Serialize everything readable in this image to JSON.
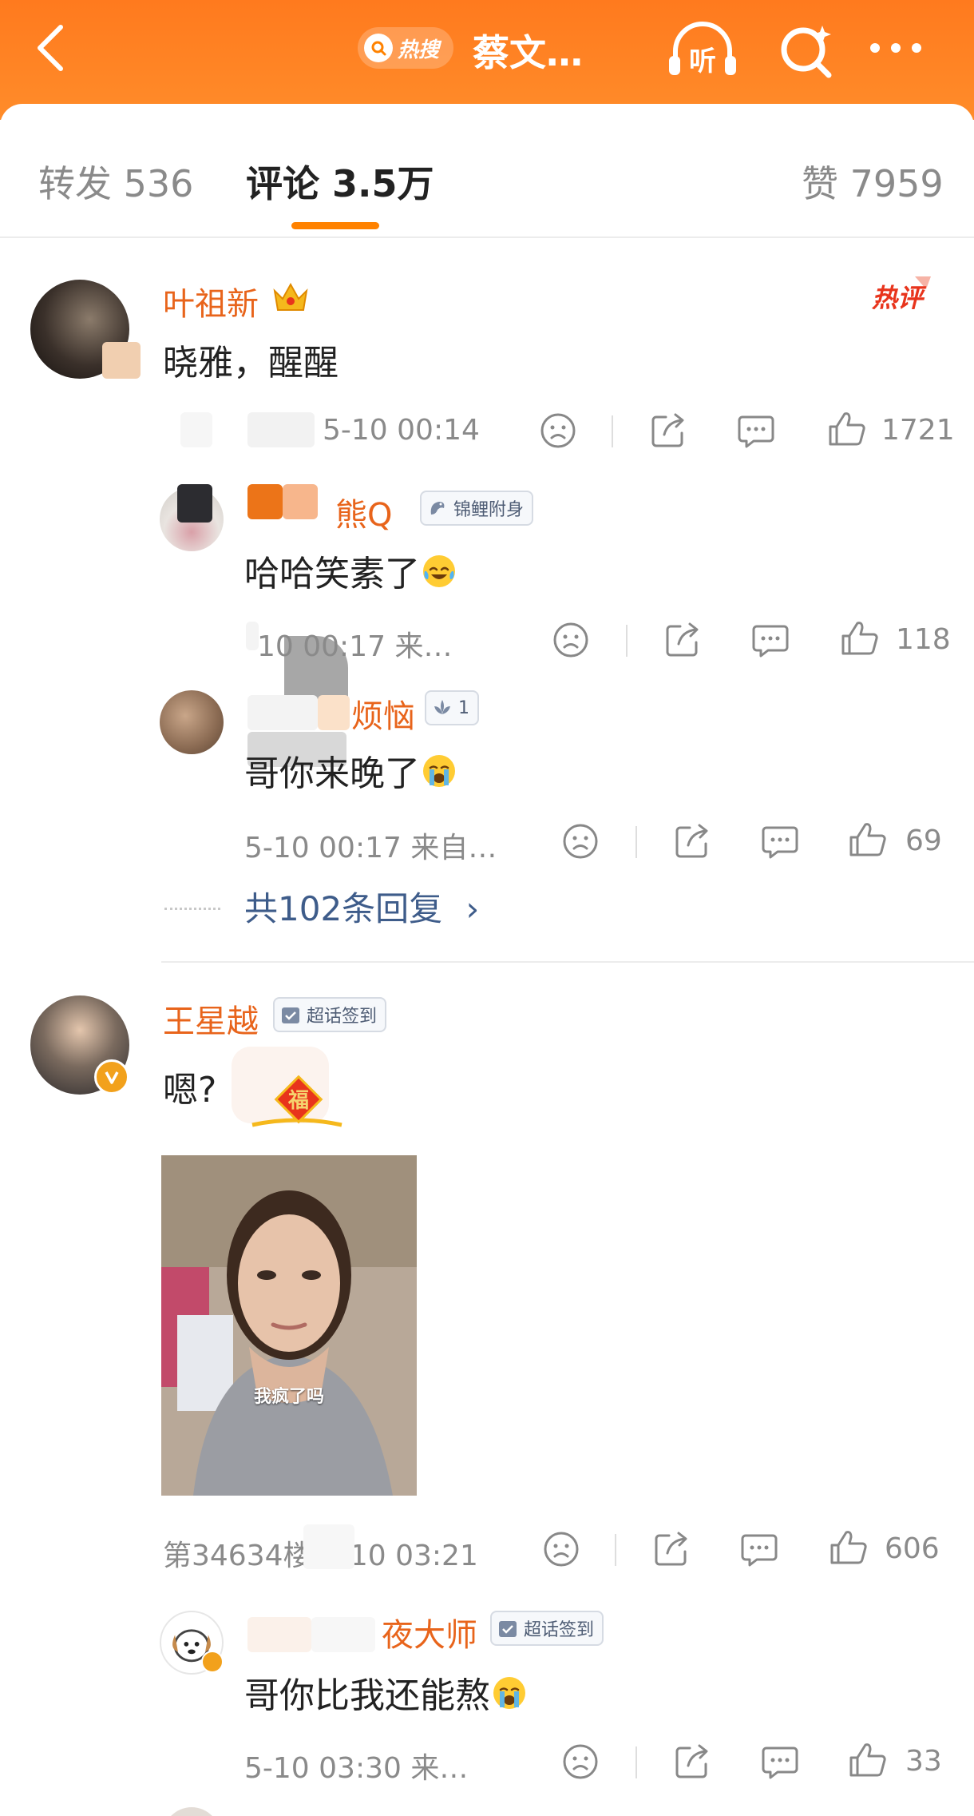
{
  "header": {
    "hot_search_label": "热搜",
    "topic_title": "蔡文…",
    "listen_label": "听",
    "accent_color": "#ff7a1e"
  },
  "tabs": {
    "reposts": "转发 536",
    "comments": "评论 3.5万",
    "likes": "赞 7959"
  },
  "comments": [
    {
      "user": "叶祖新",
      "hot_label": "热评",
      "text": "晓雅，醒醒",
      "time": "5-10 00:14",
      "likes": "1721",
      "replies": [
        {
          "user": "熊Q",
          "badge": "锦鲤附身",
          "text": "哈哈笑素了",
          "time": "10 00:17 来…",
          "likes": "118"
        },
        {
          "user": "烦恼",
          "badge": "1",
          "text": "哥你来晚了",
          "time": "5-10 00:17 来自…",
          "likes": "69"
        }
      ],
      "more_replies": "共102条回复"
    },
    {
      "user": "王星越",
      "badge": "超话签到",
      "text": "嗯?",
      "image_caption": "我疯了吗",
      "time": "第34634楼 5-10 03:21",
      "likes": "606",
      "replies": [
        {
          "user": "夜大师",
          "badge": "超话签到",
          "text": "哥你比我还能熬",
          "time": "5-10 03:30 来…",
          "likes": "33"
        }
      ]
    }
  ],
  "icons": [
    "back-icon",
    "hot-search-icon",
    "listen-icon",
    "search-icon",
    "more-icon",
    "dislike-icon",
    "share-icon",
    "reply-icon",
    "like-icon"
  ]
}
